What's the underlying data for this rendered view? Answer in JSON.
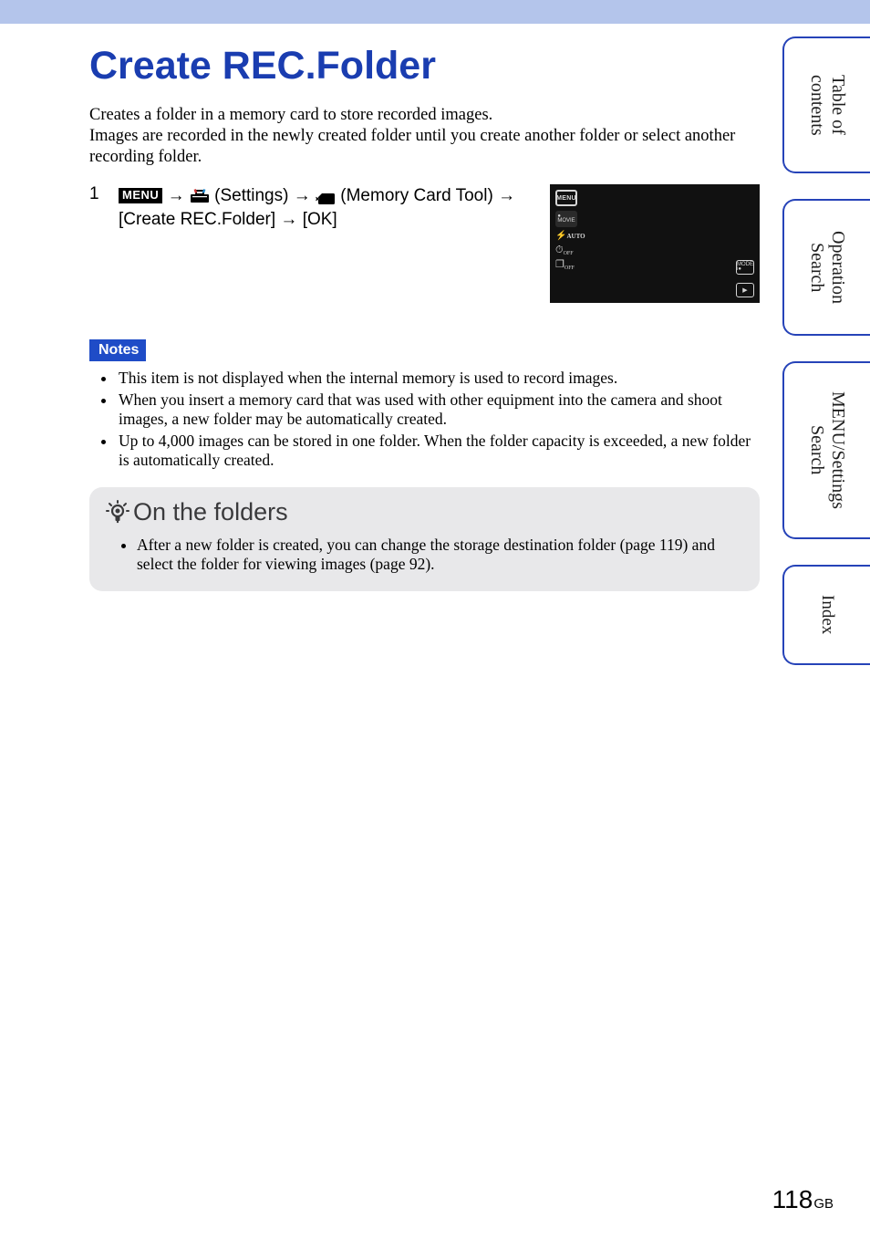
{
  "title": "Create REC.Folder",
  "intro": "Creates a folder in a memory card to store recorded images.\nImages are recorded in the newly created folder until you create another folder or select another recording folder.",
  "step": {
    "number": "1",
    "menu_label": "MENU",
    "part1": " (Settings) ",
    "part2": " (Memory Card Tool) ",
    "part3": " [Create REC.Folder] ",
    "part4": " [OK]",
    "arrow": "→"
  },
  "notes_label": "Notes",
  "notes": [
    "This item is not displayed when the internal memory is used to record images.",
    "When you insert a memory card that was used with other equipment into the camera and shoot images, a new folder may be automatically created.",
    "Up to 4,000 images can be stored in one folder. When the folder capacity is exceeded, a new folder is automatically created."
  ],
  "tip_title": "On the folders",
  "tip_body": "After a new folder is created, you can change the storage destination folder (page 119) and select the folder for viewing images (page 92).",
  "tabs": {
    "toc": "Table of\ncontents",
    "op": "Operation\nSearch",
    "menu": "MENU/Settings\nSearch",
    "index": "Index"
  },
  "page": {
    "num": "118",
    "suffix": "GB"
  },
  "thumb_menu": "MENU"
}
